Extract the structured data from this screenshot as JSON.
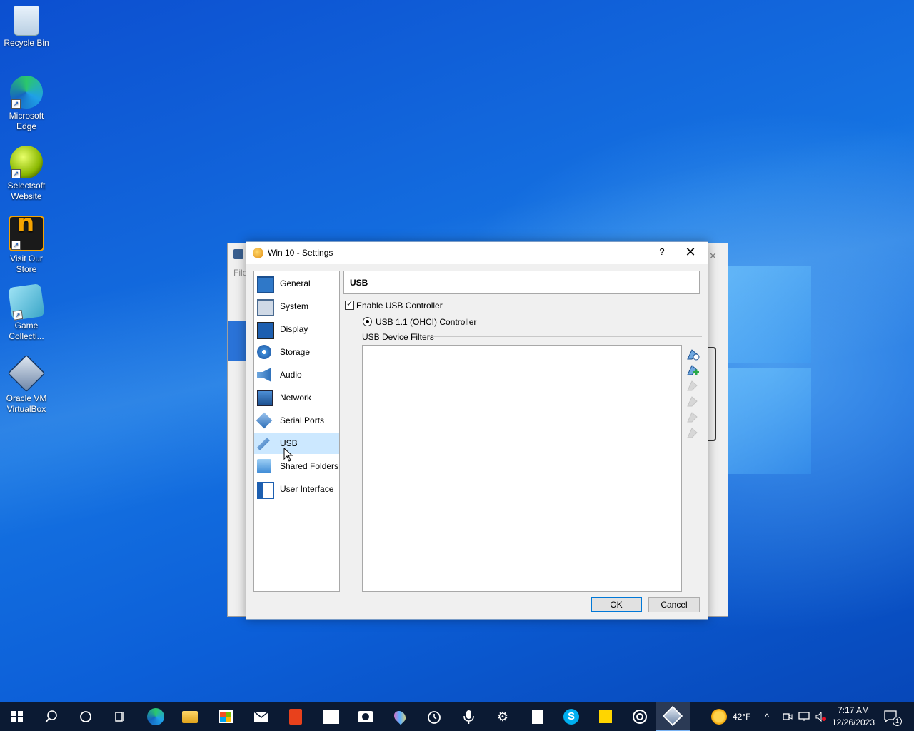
{
  "desktop": {
    "icons": [
      {
        "label": "Recycle Bin"
      },
      {
        "label": "Microsoft Edge"
      },
      {
        "label": "Selectsoft Website"
      },
      {
        "label": "Visit Our Store"
      },
      {
        "label": "Game Collecti..."
      },
      {
        "label": "Oracle VM VirtualBox"
      }
    ]
  },
  "background_window": {
    "menu_file": "File"
  },
  "dialog": {
    "title": "Win 10 - Settings",
    "help": "?",
    "close": "✕",
    "nav": [
      {
        "label": "General",
        "icon": "general-icon"
      },
      {
        "label": "System",
        "icon": "system-icon"
      },
      {
        "label": "Display",
        "icon": "display-icon"
      },
      {
        "label": "Storage",
        "icon": "storage-icon"
      },
      {
        "label": "Audio",
        "icon": "audio-icon"
      },
      {
        "label": "Network",
        "icon": "network-icon"
      },
      {
        "label": "Serial Ports",
        "icon": "serial-ports-icon"
      },
      {
        "label": "USB",
        "icon": "usb-icon"
      },
      {
        "label": "Shared Folders",
        "icon": "shared-folders-icon"
      },
      {
        "label": "User Interface",
        "icon": "user-interface-icon"
      }
    ],
    "selected_nav": "USB",
    "section_title": "USB",
    "enable_usb_label": "Enable USB Controller",
    "enable_usb_checked": true,
    "usb_controller_option": "USB 1.1 (OHCI) Controller",
    "filters_label": "USB Device Filters",
    "ok_label": "OK",
    "cancel_label": "Cancel"
  },
  "taskbar": {
    "weather_temp": "42°F",
    "time": "7:17 AM",
    "date": "12/26/2023",
    "notifications": "1"
  },
  "colors": {
    "selection": "#cce8ff",
    "taskbar": "#0b1a33",
    "accent": "#0078d7"
  }
}
